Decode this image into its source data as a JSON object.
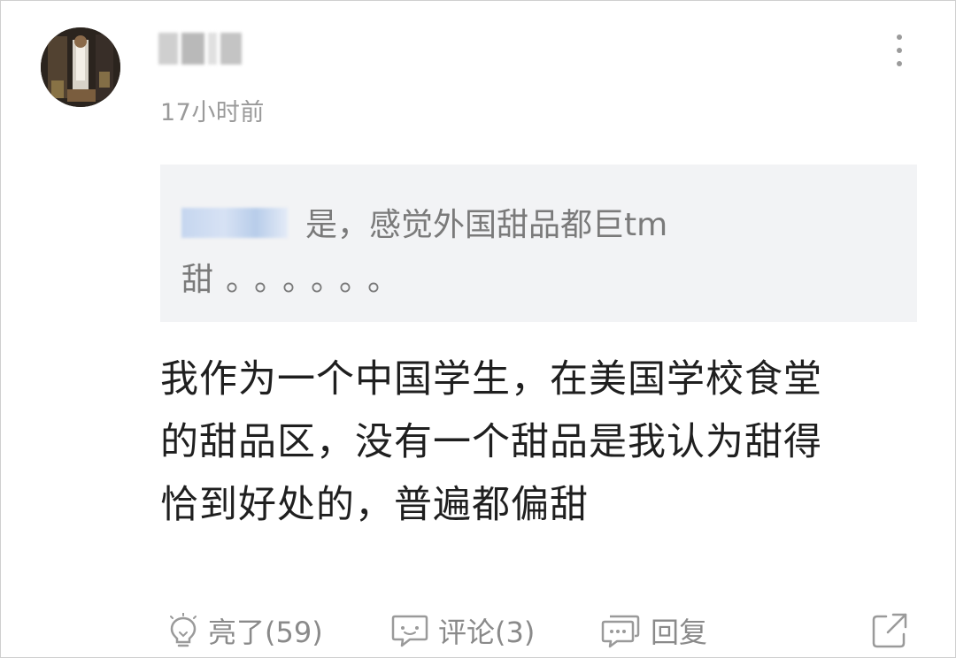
{
  "comment": {
    "time": "17小时前",
    "quote": {
      "line1_text": "是，感觉外国甜品都巨tm",
      "line2_text": "甜。。。。。。"
    },
    "body_lines": [
      "我作为一个中国学生，在美国学校食堂",
      "的甜品区，没有一个甜品是我认为甜得",
      "恰到好处的，普遍都偏甜"
    ]
  },
  "actions": {
    "like_label": "亮了(59)",
    "comment_label": "评论(3)",
    "reply_label": "回复"
  },
  "icons": {
    "avatar": "avatar-image",
    "more": "more-vertical-icon",
    "like": "lightbulb-icon",
    "comment": "comment-bubble-icon",
    "reply": "reply-bubble-icon",
    "share": "share-icon"
  },
  "colors": {
    "quote_background": "#f2f3f5",
    "body_text": "#1f1f1f",
    "meta_text": "#9a9a9a"
  }
}
